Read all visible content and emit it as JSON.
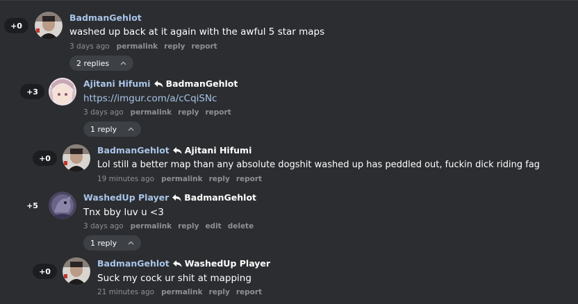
{
  "comments": [
    {
      "score": "+0",
      "username": "BadmanGehlot",
      "reply_to": "",
      "body": "washed up back at it again with the awful 5 star maps",
      "time": "3 days ago",
      "actions": [
        "permalink",
        "reply",
        "report"
      ],
      "replies_label": "2 replies"
    },
    {
      "score": "+3",
      "username": "Ajitani Hifumi",
      "reply_to": "BadmanGehlot",
      "body": "https://imgur.com/a/cCqiSNc",
      "time": "3 days ago",
      "actions": [
        "permalink",
        "reply",
        "report"
      ],
      "replies_label": "1 reply"
    },
    {
      "score": "+0",
      "username": "BadmanGehlot",
      "reply_to": "Ajitani Hifumi",
      "body": "Lol still a better map than any absolute dogshit washed up has peddled out, fuckin dick riding fag",
      "time": "19 minutes ago",
      "actions": [
        "permalink",
        "reply",
        "report"
      ]
    },
    {
      "score": "+5",
      "username": "WashedUp Player",
      "reply_to": "BadmanGehlot",
      "body": "Tnx bby luv u <3",
      "time": "3 days ago",
      "actions": [
        "permalink",
        "reply",
        "edit",
        "delete"
      ],
      "replies_label": "1 reply"
    },
    {
      "score": "+0",
      "username": "BadmanGehlot",
      "reply_to": "WashedUp Player",
      "body": "Suck my cock ur shit at mapping",
      "time": "21 minutes ago",
      "actions": [
        "permalink",
        "reply",
        "report"
      ]
    }
  ],
  "icons": {
    "reply_arrow": "reply-arrow-icon",
    "collapse": "chevron-up-icon"
  },
  "colors": {
    "background": "#2b2d30",
    "username": "#a9c4e8",
    "meta": "#8d9096",
    "pill": "#3d4045",
    "score_badge": "#1c1d20"
  }
}
